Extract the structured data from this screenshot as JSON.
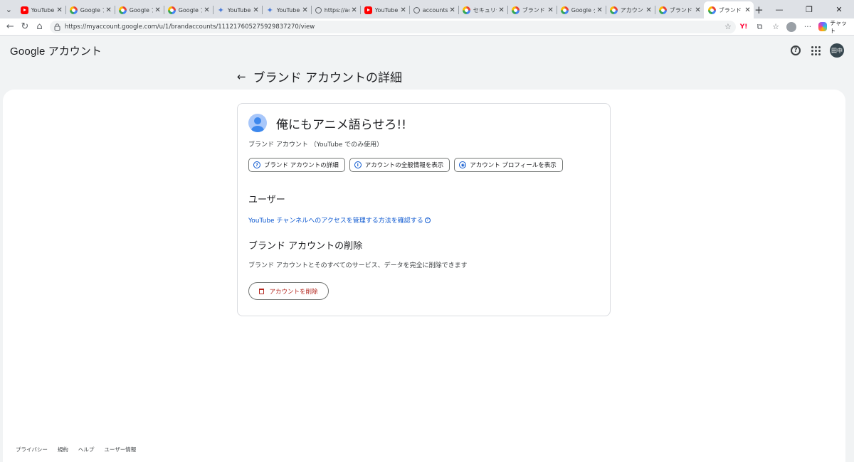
{
  "browser": {
    "tabs": [
      {
        "title": "YouTube",
        "favicon": "youtube-icon"
      },
      {
        "title": "Google アカ",
        "favicon": "google-icon"
      },
      {
        "title": "Google アカ",
        "favicon": "google-icon"
      },
      {
        "title": "Google アカ",
        "favicon": "google-icon"
      },
      {
        "title": "YouTubeの",
        "favicon": "gemini-icon"
      },
      {
        "title": "YouTubeの",
        "favicon": "gemini-icon"
      },
      {
        "title": "https://acc",
        "favicon": "globe-icon"
      },
      {
        "title": "YouTube",
        "favicon": "youtube-icon"
      },
      {
        "title": "accounts.g",
        "favicon": "globe-icon"
      },
      {
        "title": "セキュリティ",
        "favicon": "google-icon"
      },
      {
        "title": "ブランド アカ",
        "favicon": "google-icon"
      },
      {
        "title": "Google ダッ",
        "favicon": "google-icon"
      },
      {
        "title": "アカウント詳",
        "favicon": "google-icon"
      },
      {
        "title": "ブランド アカ",
        "favicon": "google-icon"
      },
      {
        "title": "ブランド アカ",
        "favicon": "google-icon",
        "active": true
      }
    ],
    "url": "https://myaccount.google.com/u/1/brandaccounts/111217605275929837270/view",
    "chat_label": "チャット"
  },
  "header": {
    "brand_google": "Google",
    "brand_suffix": " アカウント",
    "avatar_initials": "田中"
  },
  "page": {
    "title": "ブランド アカウントの詳細",
    "account_name": "俺にもアニメ語らせろ!!",
    "account_type": "ブランド アカウント （YouTube でのみ使用）",
    "chips": [
      {
        "label": "ブランド アカウントの詳細",
        "icon": "help-circle-icon"
      },
      {
        "label": "アカウントの全般情報を表示",
        "icon": "info-circle-icon"
      },
      {
        "label": "アカウント プロフィールを表示",
        "icon": "account-circle-icon"
      }
    ],
    "users_heading": "ユーザー",
    "users_link": "YouTube チャンネルへのアクセスを管理する方法を確認する",
    "delete_heading": "ブランド アカウントの削除",
    "delete_desc": "ブランド アカウントとそのすべてのサービス、データを完全に削除できます",
    "delete_button": "アカウントを削除"
  },
  "footer": {
    "links": [
      "プライバシー",
      "規約",
      "ヘルプ",
      "ユーザー情報"
    ]
  },
  "colors": {
    "link": "#0b57d0",
    "danger": "#b3261e",
    "avatar_bg": "#37474f"
  }
}
